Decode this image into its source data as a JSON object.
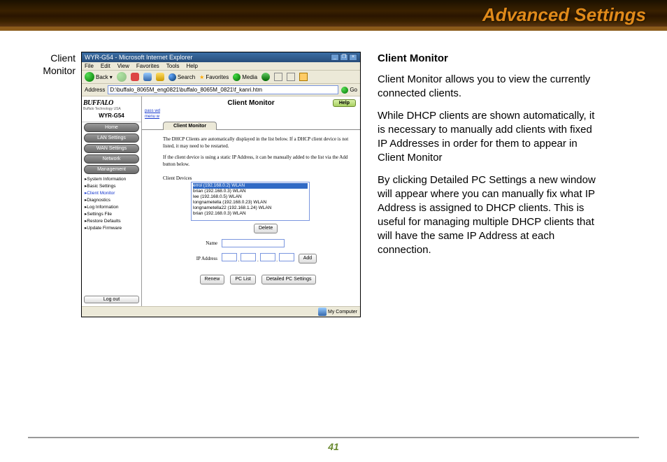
{
  "doc": {
    "header_title": "Advanced Settings",
    "left_label_l1": "Client",
    "left_label_l2": "Monitor",
    "page_number": "41"
  },
  "browser": {
    "title": "WYR-G54 - Microsoft Internet Explorer",
    "menu": [
      "File",
      "Edit",
      "View",
      "Favorites",
      "Tools",
      "Help"
    ],
    "back": "Back",
    "search": "Search",
    "favorites_btn": "Favorites",
    "media": "Media",
    "address_label": "Address",
    "address_value": "D:\\buffalo_8065M_eng0821\\buffalo_8065M_0821\\f_kanri.htm",
    "go": "Go",
    "status": "My Computer"
  },
  "router": {
    "brand": "BUFFALO",
    "brand_sub": "Buffalo Technology USA",
    "model": "WYR-G54",
    "pass1": "pass  wd",
    "pass2": "menu  w",
    "nav": {
      "home": "Home",
      "lan": "LAN Settings",
      "wan": "WAN Settings",
      "network": "Network",
      "mgmt": "Management"
    },
    "sub": {
      "sysinfo": "System Information",
      "basic": "Basic Settings",
      "client": "Client Monitor",
      "diag": "Diagnostics",
      "log": "Log Information",
      "sfile": "Settings File",
      "restore": "Restore Defaults",
      "firmware": "Update Firmware"
    },
    "logout": "Log out",
    "page_title": "Client Monitor",
    "help": "Help",
    "tab": "Client Monitor",
    "body_p1": "The DHCP Clients are automatically displayed in the list below. If a DHCP client device is not listed, it may need to be restarted.",
    "body_p2": "If the client device is using a static IP Address, it can be manually added to the list via the Add button below.",
    "devices_label": "Client Devices",
    "devices": [
      "errol (192.168.0.2) WLAN",
      "brian (192.168.0.3) WLAN",
      "lee (192.168.0.5) WLAN",
      "longnametella (192.168.0.23) WLAN",
      "longnametella22 (192.168.1.24) WLAN",
      "brian (192.168.0.3) WLAN"
    ],
    "delete": "Delete",
    "name_label": "Name",
    "ip_label": "IP Address",
    "add": "Add",
    "renew": "Renew",
    "pclist": "PC List",
    "detailed": "Detailed PC Settings"
  },
  "text": {
    "heading": "Client Monitor",
    "p1": "Client Monitor allows you to view the currently connected clients.",
    "p2": "While DHCP clients are shown automatically, it is necessary to manually add clients with fixed IP Addresses in order for them to appear in Client Monitor",
    "p3": "By clicking Detailed PC Settings a new window will appear where you can manually fix what IP Address is assigned to DHCP clients. This is useful for manag­ing multiple DHCP clients that will have the same IP Address at each connection."
  }
}
